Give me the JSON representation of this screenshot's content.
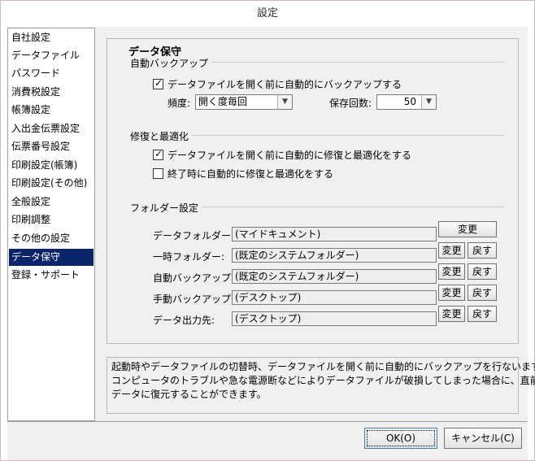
{
  "window": {
    "title": "設定"
  },
  "sidebar": {
    "items": [
      {
        "label": "自社設定"
      },
      {
        "label": "データファイル"
      },
      {
        "label": "パスワード"
      },
      {
        "label": "消費税設定"
      },
      {
        "label": "帳簿設定"
      },
      {
        "label": "入出金伝票設定"
      },
      {
        "label": "伝票番号設定"
      },
      {
        "label": "印刷設定(帳簿)"
      },
      {
        "label": "印刷設定(その他)"
      },
      {
        "label": "全般設定"
      },
      {
        "label": "印刷調整"
      },
      {
        "label": "その他の設定"
      },
      {
        "label": "データ保守"
      },
      {
        "label": "登録・サポート"
      }
    ],
    "selected": "データ保守"
  },
  "main": {
    "group_title": "データ保守",
    "auto_backup": {
      "section_label": "自動バックアップ",
      "checkbox_label": "データファイルを開く前に自動的にバックアップする",
      "checked": true,
      "frequency_label": "頻度:",
      "frequency_value": "開く度毎回",
      "count_label": "保存回数:",
      "count_value": "50"
    },
    "repair": {
      "section_label": "修復と最適化",
      "checkbox1_label": "データファイルを開く前に自動的に修復と最適化をする",
      "checkbox1_checked": true,
      "checkbox2_label": "終了時に自動的に修復と最適化をする",
      "checkbox2_checked": false
    },
    "folders": {
      "section_label": "フォルダー設定",
      "change_label": "変更",
      "reset_label": "戻す",
      "rows": [
        {
          "label": "データフォルダー:",
          "path": "(マイドキュメント)"
        },
        {
          "label": "一時フォルダー:",
          "path": "(既定のシステムフォルダー)"
        },
        {
          "label": "自動バックアップ:",
          "path": "(既定のシステムフォルダー)"
        },
        {
          "label": "手動バックアップ:",
          "path": "(デスクトップ)"
        },
        {
          "label": "データ出力先:",
          "path": "(デスクトップ)"
        }
      ]
    },
    "description": {
      "lines": [
        "起動時やデータファイルの切替時、データファイルを開く前に自動的にバックアップを行ないます。",
        "コンピュータのトラブルや急な電源断などによりデータファイルが破損してしまった場合に、直前の",
        "データに復元することができます。"
      ]
    }
  },
  "footer": {
    "ok_label": "OK(O)",
    "cancel_label": "キャンセル(C)"
  },
  "icons": {
    "check": "check-mark-icon",
    "dropdown": "chevron-down-icon"
  },
  "colors": {
    "selection": "#0a246a",
    "background": "#f0f0f0"
  }
}
